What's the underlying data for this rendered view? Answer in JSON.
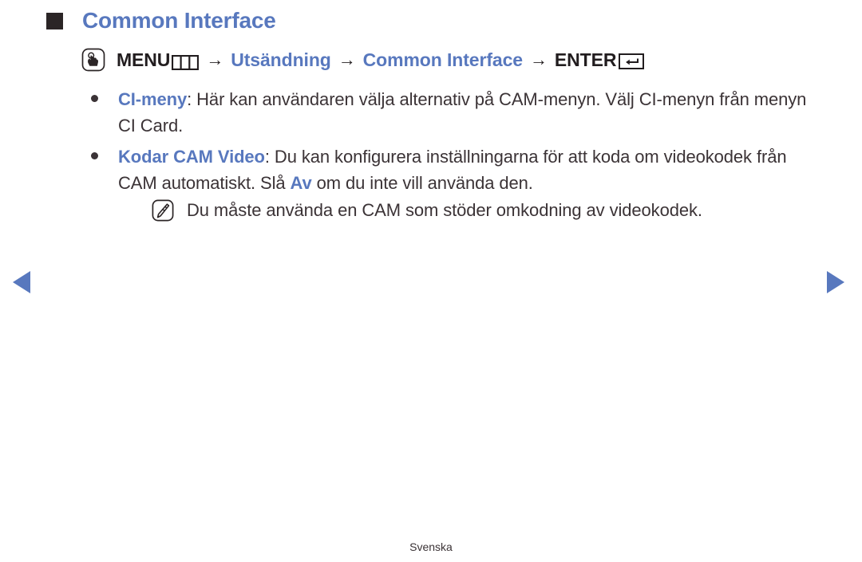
{
  "page": {
    "title": "Common Interface",
    "footer_language": "Svenska",
    "accent_color": "#5878be",
    "text_color": "#3b3336"
  },
  "menu_path": {
    "touch_icon": "touch-hand-icon",
    "menu_label": "MENU",
    "menu_icon": "menu-grid-icon",
    "sep1": "→",
    "step2": "Utsändning",
    "sep2": "→",
    "step3": "Common Interface",
    "sep3": "→",
    "enter_label": "ENTER",
    "enter_icon": "enter-return-key-icon"
  },
  "bullets": [
    {
      "keyword": "CI-meny",
      "separator": ": ",
      "text": "Här kan användaren välja alternativ på CAM-menyn. Välj CI-menyn från menyn CI Card."
    },
    {
      "keyword": "Kodar CAM Video",
      "separator": ": ",
      "text_before": "Du kan konfigurera inställningarna för att koda om videokodek från CAM automatiskt. Slå ",
      "highlight": "Av",
      "text_after": " om du inte vill använda den."
    }
  ],
  "note": {
    "icon": "note-pencil-icon",
    "text": "Du måste använda en CAM som stöder omkodning av videokodek."
  },
  "navigation": {
    "prev_icon": "triangle-left-icon",
    "next_icon": "triangle-right-icon"
  }
}
